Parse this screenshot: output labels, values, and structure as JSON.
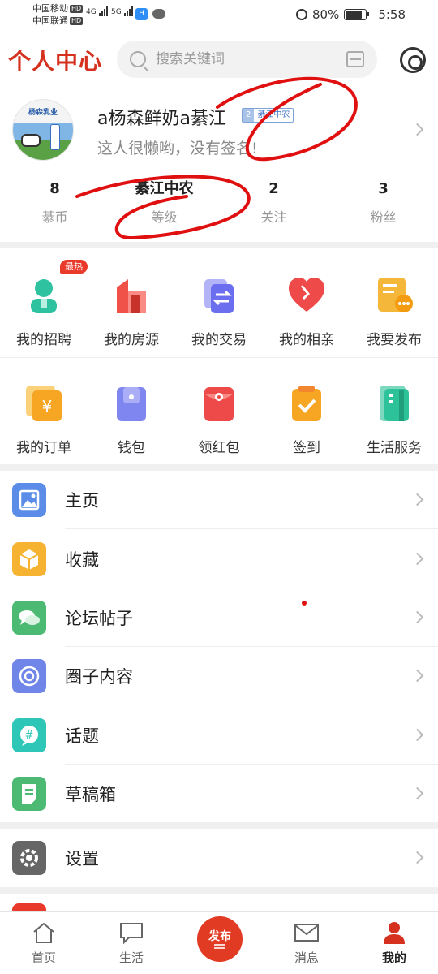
{
  "status_bar": {
    "carrier1": "中国移动",
    "carrier2": "中国联通",
    "hd": "HD",
    "net1": "4G",
    "net2": "5G",
    "battery": "80%",
    "time": "5:58"
  },
  "header": {
    "title": "个人中心",
    "search_placeholder": "搜索关键词"
  },
  "profile": {
    "username": "a杨森鲜奶a綦江",
    "level_num": "2",
    "level_name": "綦江中农",
    "signature": "这人很懒哟，没有签名!",
    "avatar_brand": "杨森乳业"
  },
  "stats": [
    {
      "value": "8",
      "label": "綦币"
    },
    {
      "value": "綦江中农",
      "label": "等级"
    },
    {
      "value": "2",
      "label": "关注"
    },
    {
      "value": "3",
      "label": "粉丝"
    }
  ],
  "grid_row1": [
    {
      "label": "我的招聘",
      "badge": "最热",
      "icon": "person-icon",
      "color": "#2ec2a0"
    },
    {
      "label": "我的房源",
      "icon": "building-icon",
      "color": "#f0524a"
    },
    {
      "label": "我的交易",
      "icon": "exchange-icon",
      "color": "#6c6ef0"
    },
    {
      "label": "我的相亲",
      "icon": "heart-icon",
      "color": "#ef4a4a"
    },
    {
      "label": "我要发布",
      "icon": "document-icon",
      "color": "#f5b73a"
    }
  ],
  "grid_row2": [
    {
      "label": "我的订单",
      "icon": "yen-icon",
      "color": "#f6a623"
    },
    {
      "label": "钱包",
      "icon": "wallet-icon",
      "color": "#7f86f0"
    },
    {
      "label": "领红包",
      "icon": "red-envelope-icon",
      "color": "#ef4a4a"
    },
    {
      "label": "签到",
      "icon": "checkin-icon",
      "color": "#f6a623"
    },
    {
      "label": "生活服务",
      "icon": "service-icon",
      "color": "#2ec29a"
    }
  ],
  "menu": [
    {
      "label": "主页",
      "icon": "image-icon",
      "color": "#5b8de8"
    },
    {
      "label": "收藏",
      "icon": "box-icon",
      "color": "#f6b332"
    },
    {
      "label": "论坛帖子",
      "icon": "chat-icon",
      "color": "#4cba73"
    },
    {
      "label": "圈子内容",
      "icon": "circle-icon",
      "color": "#6f86e8"
    },
    {
      "label": "话题",
      "icon": "hashtag-icon",
      "color": "#2ec6b6"
    },
    {
      "label": "草稿箱",
      "icon": "draft-icon",
      "color": "#4cba73"
    }
  ],
  "settings": {
    "label": "设置",
    "color": "#666666"
  },
  "bottom_nav": [
    {
      "label": "首页",
      "icon": "home-icon"
    },
    {
      "label": "生活",
      "icon": "life-chat-icon"
    },
    {
      "label": "发布",
      "icon": "publish-icon"
    },
    {
      "label": "消息",
      "icon": "mail-icon"
    },
    {
      "label": "我的",
      "icon": "profile-icon"
    }
  ],
  "colors": {
    "brand": "#d5311e",
    "annotation": "#e01010"
  }
}
